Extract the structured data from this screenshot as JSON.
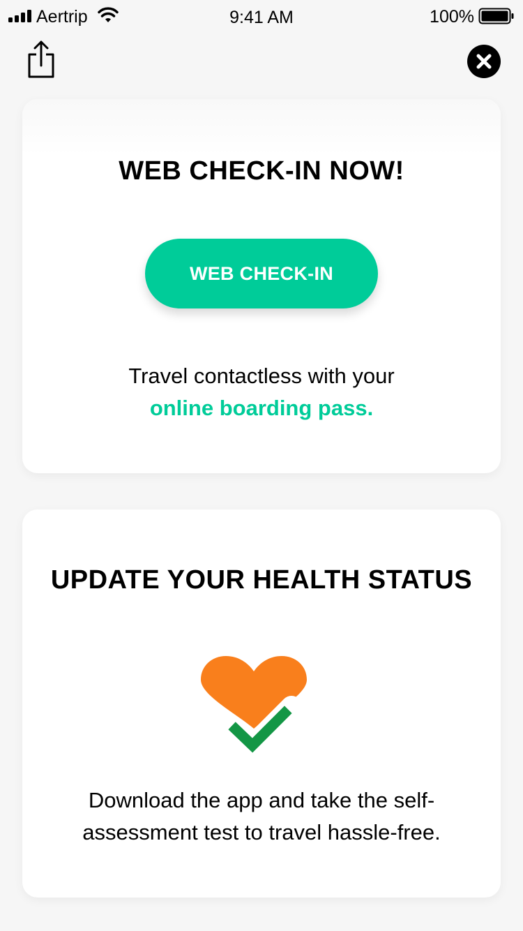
{
  "status_bar": {
    "carrier": "Aertrip",
    "time": "9:41 AM",
    "battery": "100%"
  },
  "icons": {
    "share": "share-icon",
    "close": "close-icon",
    "heart": "heart-check-icon"
  },
  "colors": {
    "accent": "#00cc99",
    "heart": "#f97f1c",
    "check": "#139645"
  },
  "checkin_card": {
    "title": "WEB CHECK-IN NOW!",
    "button_label": "WEB CHECK-IN",
    "text_line1": "Travel contactless with your",
    "text_highlight": "online boarding pass."
  },
  "health_card": {
    "title": "UPDATE YOUR HEALTH STATUS",
    "text_line1": "Download the app and take the self-",
    "text_line2": "assessment test to travel hassle-free."
  }
}
